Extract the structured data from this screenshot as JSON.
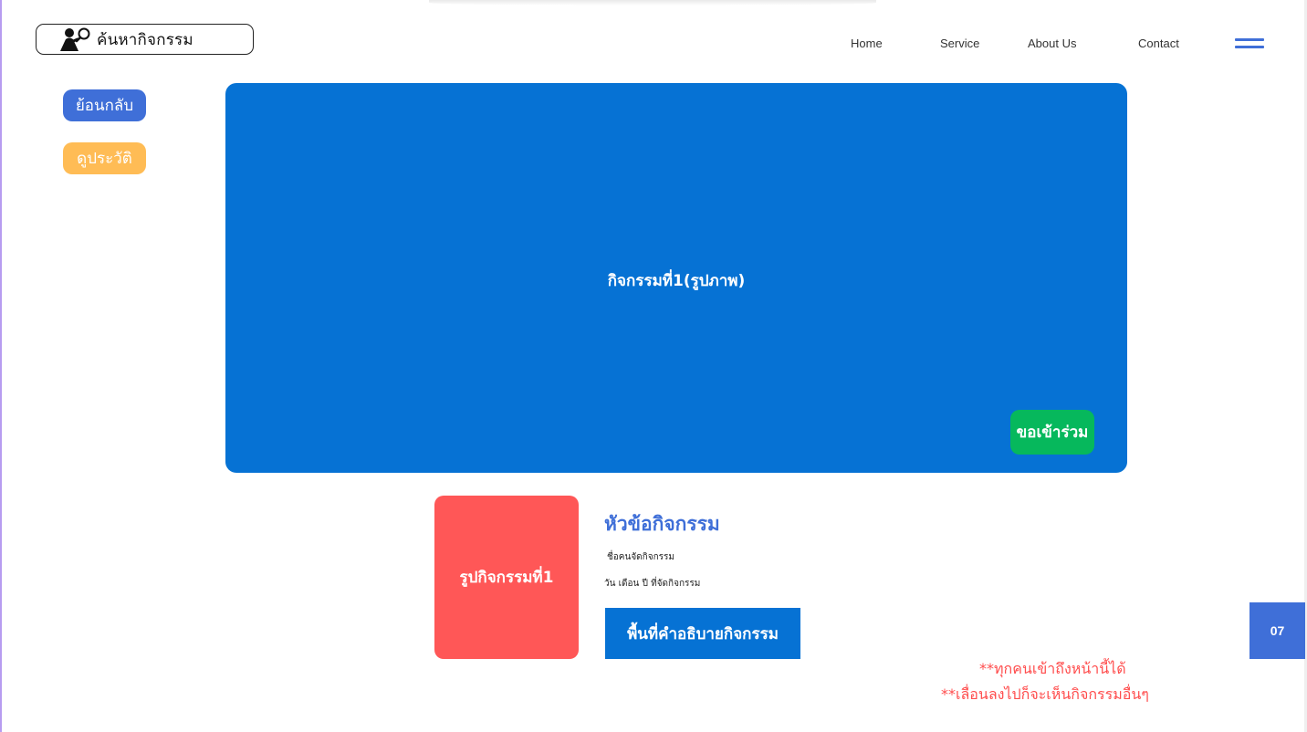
{
  "search": {
    "label": "ค้นหากิจกรรม",
    "icon": "person-magnifier-icon"
  },
  "nav": {
    "items": [
      {
        "label": "Home"
      },
      {
        "label": "Service"
      },
      {
        "label": "About Us"
      },
      {
        "label": "Contact"
      }
    ],
    "menu_icon": "hamburger-menu-icon"
  },
  "sidebar": {
    "back_label": "ย้อนกลับ",
    "history_label": "ดูประวัติ"
  },
  "hero": {
    "caption": "กิจกรรมที่1(รูปภาพ)",
    "join_label": "ขอเข้าร่วม"
  },
  "activity": {
    "thumbnail_label": "รูปกิจกรรมที่1",
    "title": "หัวข้อกิจกรรม",
    "organizer": "ชื่อคนจัดกิจกรรม",
    "date": "วัน เดือน ปี ที่จัดกิจกรรม",
    "description": "พื้นที่คำอธิบายกิจกรรม"
  },
  "notes": {
    "line1": "**ทุกคนเข้าถึงหน้านี้ได้",
    "line2": "**เลื่อนลงไปก็จะเห็นกิจกรรมอื่นๆ"
  },
  "page_number": "07",
  "colors": {
    "primary_blue": "#0672d4",
    "accent_blue": "#3f6fd8",
    "orange": "#ffbc55",
    "green": "#06b85c",
    "red": "#ff5757",
    "note_red": "#ff4d4d"
  }
}
